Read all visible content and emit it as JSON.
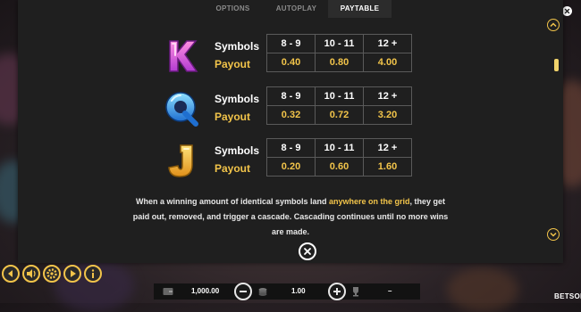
{
  "tabs": [
    "OPTIONS",
    "AUTOPLAY",
    "PAYTABLE"
  ],
  "active_tab": "PAYTABLE",
  "symbols": [
    {
      "letter": "K",
      "icon": "k-symbol-icon",
      "symbols_label": "Symbols",
      "payout_label": "Payout",
      "headers": [
        "8 - 9",
        "10 - 11",
        "12 +"
      ],
      "payouts": [
        "0.40",
        "0.80",
        "4.00"
      ]
    },
    {
      "letter": "Q",
      "icon": "q-symbol-icon",
      "symbols_label": "Symbols",
      "payout_label": "Payout",
      "headers": [
        "8 - 9",
        "10 - 11",
        "12 +"
      ],
      "payouts": [
        "0.32",
        "0.72",
        "3.20"
      ]
    },
    {
      "letter": "J",
      "icon": "j-symbol-icon",
      "symbols_label": "Symbols",
      "payout_label": "Payout",
      "headers": [
        "8 - 9",
        "10 - 11",
        "12 +"
      ],
      "payouts": [
        "0.20",
        "0.60",
        "1.60"
      ]
    }
  ],
  "description": {
    "part1": "When a winning amount of identical symbols land ",
    "highlight": "anywhere on the grid",
    "part2": ", they get paid out, removed, and trigger a cascade. Cascading continues until no more wins are made."
  },
  "bottom_bar": {
    "balance": "1,000.00",
    "bet": "1.00",
    "win": "–"
  },
  "brand": "BETSOFT",
  "colors": {
    "accent": "#f2c44a",
    "panel": "#1f1f1f"
  },
  "icons": {
    "controls": [
      "back-arrow-icon",
      "sound-icon",
      "settings-gear-icon",
      "play-icon",
      "info-icon"
    ],
    "balance": "wallet-icon",
    "bet": "coin-stack-icon",
    "win": "trophy-icon"
  }
}
